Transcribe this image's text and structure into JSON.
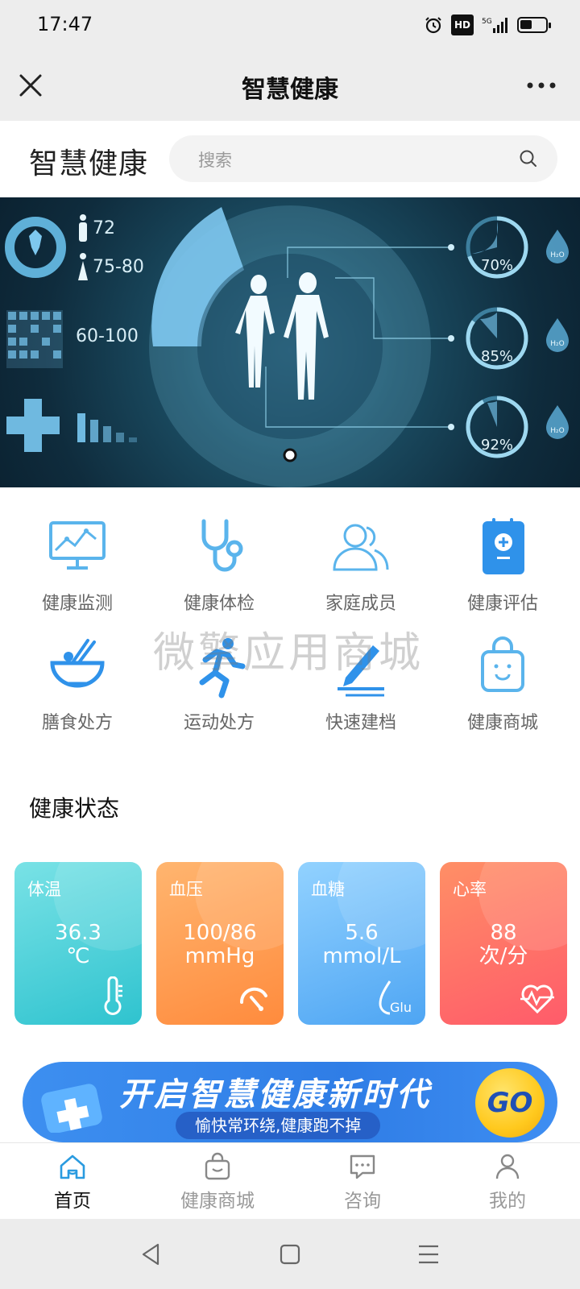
{
  "status_bar": {
    "time": "17:47",
    "hd": "HD",
    "network": "5G"
  },
  "nav": {
    "title": "智慧健康"
  },
  "header": {
    "brand": "智慧健康",
    "search_placeholder": "搜索"
  },
  "banner": {
    "left_labels": [
      "72",
      "75-80",
      "60-100"
    ],
    "percentages": [
      "70%",
      "85%",
      "92%"
    ],
    "drop_label": "H₂O",
    "slide_count": 1,
    "active_slide": 0
  },
  "grid": [
    {
      "label": "健康监测",
      "icon": "monitor-chart-icon"
    },
    {
      "label": "健康体检",
      "icon": "stethoscope-icon"
    },
    {
      "label": "家庭成员",
      "icon": "family-icon"
    },
    {
      "label": "健康评估",
      "icon": "clipboard-plus-icon"
    },
    {
      "label": "膳食处方",
      "icon": "bowl-chopsticks-icon"
    },
    {
      "label": "运动处方",
      "icon": "runner-icon"
    },
    {
      "label": "快速建档",
      "icon": "pen-icon"
    },
    {
      "label": "健康商城",
      "icon": "shopping-bag-icon"
    }
  ],
  "watermark": "微擎应用商城",
  "health_status": {
    "title": "健康状态",
    "cards": [
      {
        "title": "体温",
        "value": "36.3",
        "unit": "℃",
        "icon": "thermometer-icon",
        "color_from": "#72e0e0",
        "color_to": "#2ec4cf"
      },
      {
        "title": "血压",
        "value": "100/86",
        "unit": "mmHg",
        "icon": "gauge-icon",
        "color_from": "#ffb06b",
        "color_to": "#ff8a3d"
      },
      {
        "title": "血糖",
        "value": "5.6",
        "unit": "mmol/L",
        "icon": "glucose-drop-icon",
        "color_from": "#8fd0ff",
        "color_to": "#52a8f5"
      },
      {
        "title": "心率",
        "value": "88",
        "unit": "次/分",
        "icon": "heart-pulse-icon",
        "color_from": "#ff8d6a",
        "color_to": "#ff5d6a"
      }
    ]
  },
  "promo": {
    "main": "开启智慧健康新时代",
    "sub": "愉快常环绕,健康跑不掉",
    "go": "GO"
  },
  "tabbar": [
    {
      "label": "首页",
      "icon": "home-icon",
      "active": true
    },
    {
      "label": "健康商城",
      "icon": "bag-icon",
      "active": false
    },
    {
      "label": "咨询",
      "icon": "chat-icon",
      "active": false
    },
    {
      "label": "我的",
      "icon": "user-icon",
      "active": false
    }
  ],
  "colors": {
    "accent": "#38a6e8",
    "icon_blue": "#4aa9ec",
    "tab_active": "#2a9be0"
  }
}
